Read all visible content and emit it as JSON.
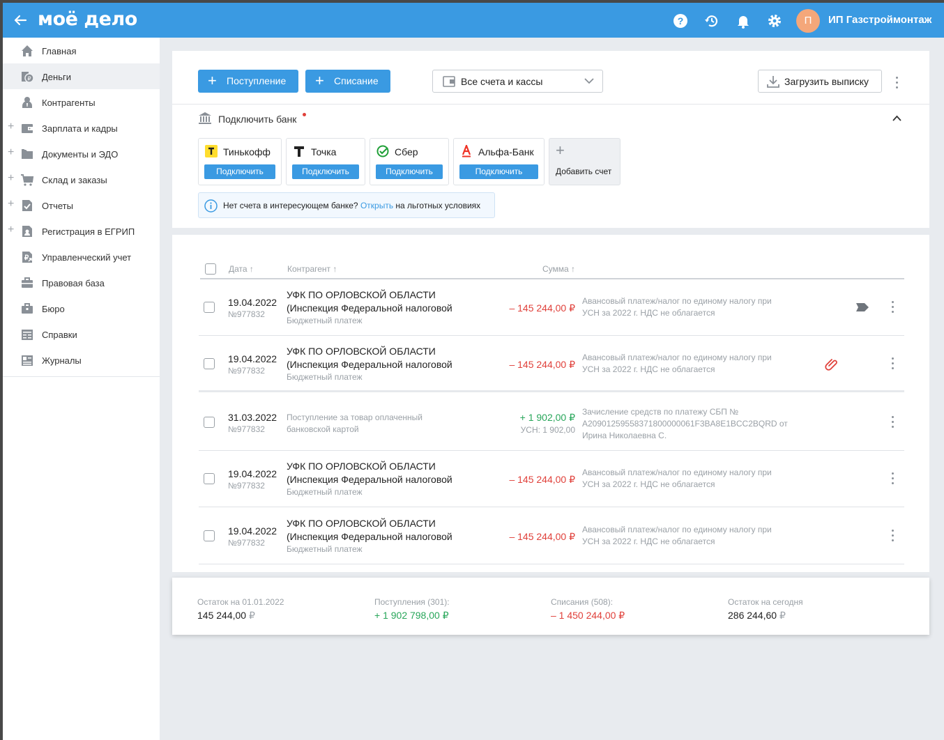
{
  "header": {
    "logo": "моё дело",
    "company": "ИП Газстроймонтаж",
    "avatar_letter": "П",
    "icons": [
      "back-arrow-icon",
      "help-icon",
      "history-icon",
      "bell-icon",
      "gear-icon"
    ]
  },
  "sidebar": {
    "items": [
      {
        "label": "Главная",
        "icon": "home-icon",
        "expandable": false
      },
      {
        "label": "Деньги",
        "icon": "money-icon",
        "expandable": false,
        "active": true
      },
      {
        "label": "Контрагенты",
        "icon": "contractors-icon",
        "expandable": false
      },
      {
        "label": "Зарплата и кадры",
        "icon": "wallet-icon",
        "expandable": true
      },
      {
        "label": "Документы и ЭДО",
        "icon": "folder-icon",
        "expandable": true
      },
      {
        "label": "Склад и заказы",
        "icon": "cart-icon",
        "expandable": true
      },
      {
        "label": "Отчеты",
        "icon": "report-icon",
        "expandable": true
      },
      {
        "label": "Регистрация в ЕГРИП",
        "icon": "registration-icon",
        "expandable": true
      },
      {
        "label": "Управленческий учет",
        "icon": "management-icon",
        "expandable": false
      },
      {
        "label": "Правовая база",
        "icon": "briefcase-icon",
        "expandable": false
      },
      {
        "label": "Бюро",
        "icon": "bureau-icon",
        "expandable": false
      },
      {
        "label": "Справки",
        "icon": "references-icon",
        "expandable": false
      },
      {
        "label": "Журналы",
        "icon": "journals-icon",
        "expandable": false
      }
    ]
  },
  "toolbar": {
    "income_label": "Поступление",
    "expense_label": "Списание",
    "accounts_select": "Все счета и кассы",
    "upload_label": "Загрузить выписку"
  },
  "banks": {
    "title": "Подключить банк",
    "connect_label": "Подключить",
    "items": [
      {
        "name": "Тинькофф",
        "color": "#ffdd2d"
      },
      {
        "name": "Точка",
        "color": "#222222"
      },
      {
        "name": "Сбер",
        "color": "#21a038"
      },
      {
        "name": "Альфа-Банк",
        "color": "#ef3124"
      }
    ],
    "add_label": "Добавить счет",
    "info_prefix": "Нет счета в интересующем банке?",
    "info_link": "Открыть",
    "info_suffix": "на льготных условиях"
  },
  "table": {
    "columns": {
      "date": "Дата ↑",
      "counterparty": "Контрагент ↑",
      "sum": "Сумма ↑"
    },
    "rows": [
      {
        "date": "19.04.2022",
        "num": "№977832",
        "cp1": "УФК ПО ОРЛОВСКОЙ ОБЛАСТИ",
        "cp2": "(Инспекция Федеральной налоговой",
        "cp3": "Бюджетный платеж",
        "amount": "– 145 244,00 ₽",
        "desc1": "Авансовый платеж/налог по единому налогу при",
        "desc2": "УСН за 2022 г. НДС не облагается",
        "extra_icon": "tag-icon"
      },
      {
        "date": "19.04.2022",
        "num": "№977832",
        "cp1": "УФК ПО ОРЛОВСКОЙ ОБЛАСТИ",
        "cp2": "(Инспекция Федеральной налоговой",
        "cp3": "Бюджетный платеж",
        "amount": "– 145 244,00 ₽",
        "desc1": "Авансовый платеж/налог по единому налогу при",
        "desc2": "УСН за 2022 г. НДС не облагается",
        "extra_icon": "paperclip-icon"
      },
      {
        "date": "31.03.2022",
        "num": "№977832",
        "cp1": "Поступление за товар оплаченный",
        "cp2": "банковской картой",
        "amount": "+ 1 902,00 ₽",
        "usn": "УСН: 1 902,00",
        "desc1": "Зачисление средств по платежу СБП №",
        "desc2": "A20901259558371800000061F3BA8E1BCC2BQRD от",
        "desc3": "Ирина Николаевна С."
      },
      {
        "date": "19.04.2022",
        "num": "№977832",
        "cp1": "УФК ПО ОРЛОВСКОЙ ОБЛАСТИ",
        "cp2": "(Инспекция Федеральной налоговой",
        "cp3": "Бюджетный платеж",
        "amount": "– 145 244,00 ₽",
        "desc1": "Авансовый платеж/налог по единому налогу при",
        "desc2": "УСН за 2022 г. НДС не облагается"
      },
      {
        "date": "19.04.2022",
        "num": "№977832",
        "cp1": "УФК ПО ОРЛОВСКОЙ ОБЛАСТИ",
        "cp2": "(Инспекция Федеральной налоговой",
        "cp3": "Бюджетный платеж",
        "amount": "– 145 244,00 ₽",
        "desc1": "Авансовый платеж/налог по единому налогу при",
        "desc2": "УСН за 2022 г. НДС не облагается"
      }
    ]
  },
  "footer": {
    "opening_label": "Остаток на 01.01.2022",
    "opening_value": "145 244,00",
    "income_label": "Поступления (301):",
    "income_value": "+ 1 902 798,00 ₽",
    "expense_label": "Списания (508):",
    "expense_value": "– 1 450 244,00 ₽",
    "today_label": "Остаток на сегодня",
    "today_value": "286 244,60",
    "currency": "₽"
  },
  "colors": {
    "brand": "#3a9ae2",
    "negative": "#e0403a",
    "positive": "#28a65a"
  }
}
